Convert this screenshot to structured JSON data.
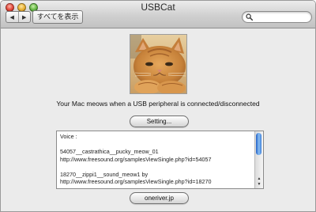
{
  "window": {
    "title": "USBCat"
  },
  "toolbar": {
    "back_icon": "◀",
    "forward_icon": "▶",
    "show_all_label": "すべてを表示",
    "search": {
      "value": "",
      "placeholder": ""
    }
  },
  "main": {
    "caption": "Your Mac meows when a USB peripheral is connected/disconnected",
    "setting_label": "Setting...",
    "credits": [
      "Voice :",
      "",
      "54057__castrathica__pucky_meow_01",
      "http://www.freesound.org/samplesViewSingle.php?id=54057",
      "",
      "18270__zippi1__sound_meow1 by",
      "http://www.freesound.org/samplesViewSingle.php?id=18270"
    ],
    "link_label": "oneriver.jp"
  },
  "colors": {
    "window_bg": "#ebebeb",
    "scroll_thumb": "#3d7fd9"
  }
}
